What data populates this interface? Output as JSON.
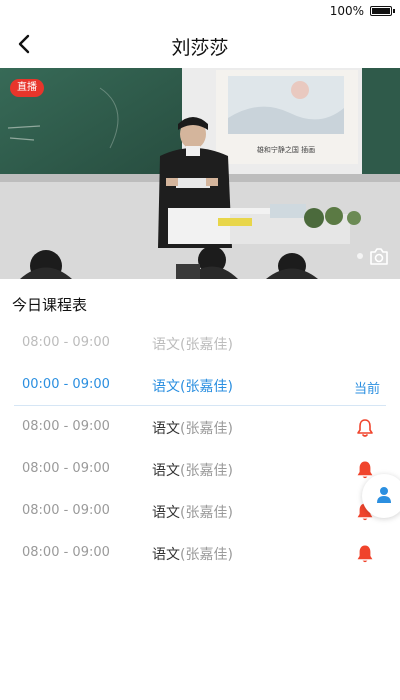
{
  "status_bar": {
    "battery_text": "100%"
  },
  "nav": {
    "title": "刘莎莎"
  },
  "video": {
    "live_badge": "直播",
    "slide_caption": "雄和宁静之国 插画",
    "colors": {
      "live": "#e8352b"
    }
  },
  "schedule": {
    "title": "今日课程表",
    "rows": [
      {
        "time": "08:00 - 09:00",
        "subject": "语文",
        "teacher": "(张嘉佳)",
        "state": "past",
        "status": ""
      },
      {
        "time": "00:00 - 09:00",
        "subject": "语文",
        "teacher": "(张嘉佳)",
        "state": "current",
        "status": "当前"
      },
      {
        "time": "08:00 - 09:00",
        "subject": "语文",
        "teacher": "(张嘉佳)",
        "state": "upcoming",
        "status": "bell-outline"
      },
      {
        "time": "08:00 - 09:00",
        "subject": "语文",
        "teacher": "(张嘉佳)",
        "state": "upcoming",
        "status": "bell-filled"
      },
      {
        "time": "08:00 - 09:00",
        "subject": "语文",
        "teacher": "(张嘉佳)",
        "state": "upcoming",
        "status": "bell-filled"
      },
      {
        "time": "08:00 - 09:00",
        "subject": "语文",
        "teacher": "(张嘉佳)",
        "state": "upcoming",
        "status": "bell-filled"
      }
    ]
  },
  "colors": {
    "accent": "#2b8fe0",
    "bell": "#f0442c"
  },
  "icons": {
    "back": "chevron-left-icon",
    "camera": "camera-icon",
    "float": "user-icon"
  }
}
